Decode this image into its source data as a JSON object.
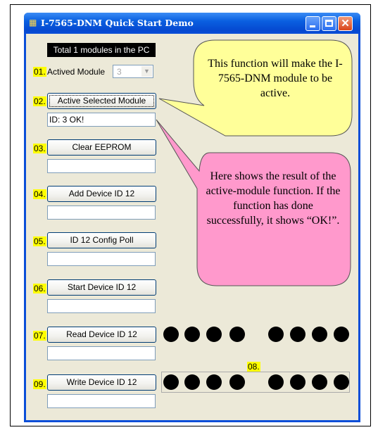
{
  "window": {
    "title": "I-7565-DNM Quick Start Demo",
    "app_icon": "app-icon",
    "controls": [
      "minimize-icon",
      "maximize-icon",
      "close-icon"
    ]
  },
  "header": {
    "total_modules": "Total  1  modules in the PC"
  },
  "steps": [
    {
      "num": "01.",
      "label": "Actived Module",
      "value": "3"
    },
    {
      "num": "02.",
      "button": "Active Selected Module",
      "result": "ID: 3 OK!"
    },
    {
      "num": "03.",
      "button": "Clear EEPROM",
      "result": ""
    },
    {
      "num": "04.",
      "button": "Add Device ID 12",
      "result": ""
    },
    {
      "num": "05.",
      "button": "ID 12 Config Poll",
      "result": ""
    },
    {
      "num": "06.",
      "button": "Start Device ID 12",
      "result": ""
    },
    {
      "num": "07.",
      "button": "Read Device ID 12",
      "result": ""
    },
    {
      "num": "09.",
      "button": "Write Device ID 12",
      "result": ""
    }
  ],
  "leds": {
    "label": "08."
  },
  "callouts": {
    "yellow": "This function will make the I-7565-DNM module to be active.",
    "pink": "Here shows the result of the active-module function. If the function has done successfully, it shows “OK!”."
  },
  "colors": {
    "titlebar": "#0a4ed8",
    "window_bg": "#ece9d8",
    "step_number_highlight": "#ffff00",
    "yellow_callout": "#ffff99",
    "pink_callout": "#ff99cc"
  }
}
